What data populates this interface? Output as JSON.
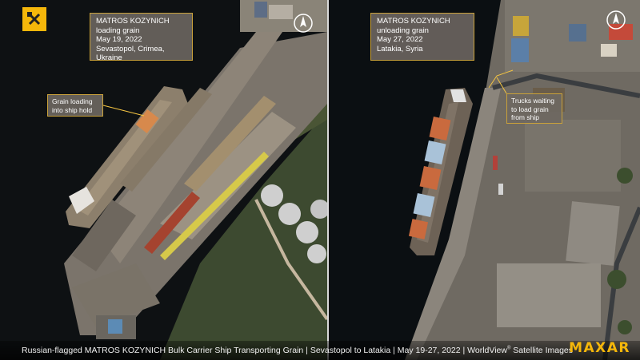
{
  "brand": {
    "logo_text": "MAXAR",
    "accent": "#f5b70a",
    "badge_icon": "tools-icon"
  },
  "left_panel": {
    "ship": "MATROS KOZYNICH",
    "activity": "loading grain",
    "date": "May 19, 2022",
    "place": "Sevastopol, Crimea, Ukraine",
    "callout_line1": "Grain loading",
    "callout_line2": "into ship hold"
  },
  "right_panel": {
    "ship": "MATROS KOZYNICH",
    "activity": "unloading grain",
    "date": "May 27, 2022",
    "place": "Latakia, Syria",
    "callout_line1": "Trucks waiting",
    "callout_line2": "to load grain",
    "callout_line3": "from ship"
  },
  "footer": {
    "caption_main": "Russian-flagged MATROS KOZYNICH Bulk Carrier Ship Transporting Grain | Sevastopol to Latakia | May 19-27, 2022 | WorldView",
    "caption_tm": "®",
    "caption_tail": " Satellite Images"
  },
  "icons": {
    "compass": "north-arrow-icon"
  }
}
